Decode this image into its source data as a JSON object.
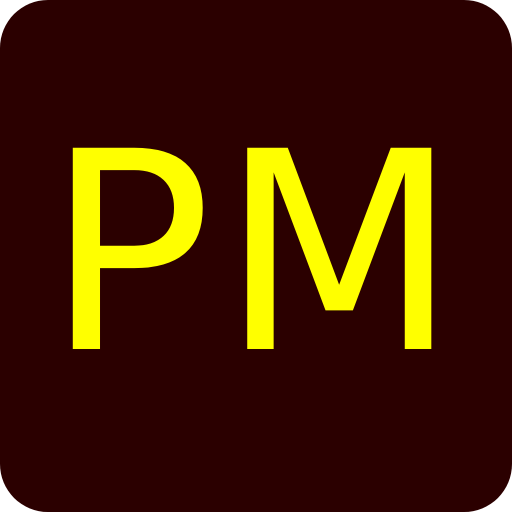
{
  "icon": {
    "label": "PM",
    "background_color": "#2b0000",
    "text_color": "#ffff00"
  }
}
